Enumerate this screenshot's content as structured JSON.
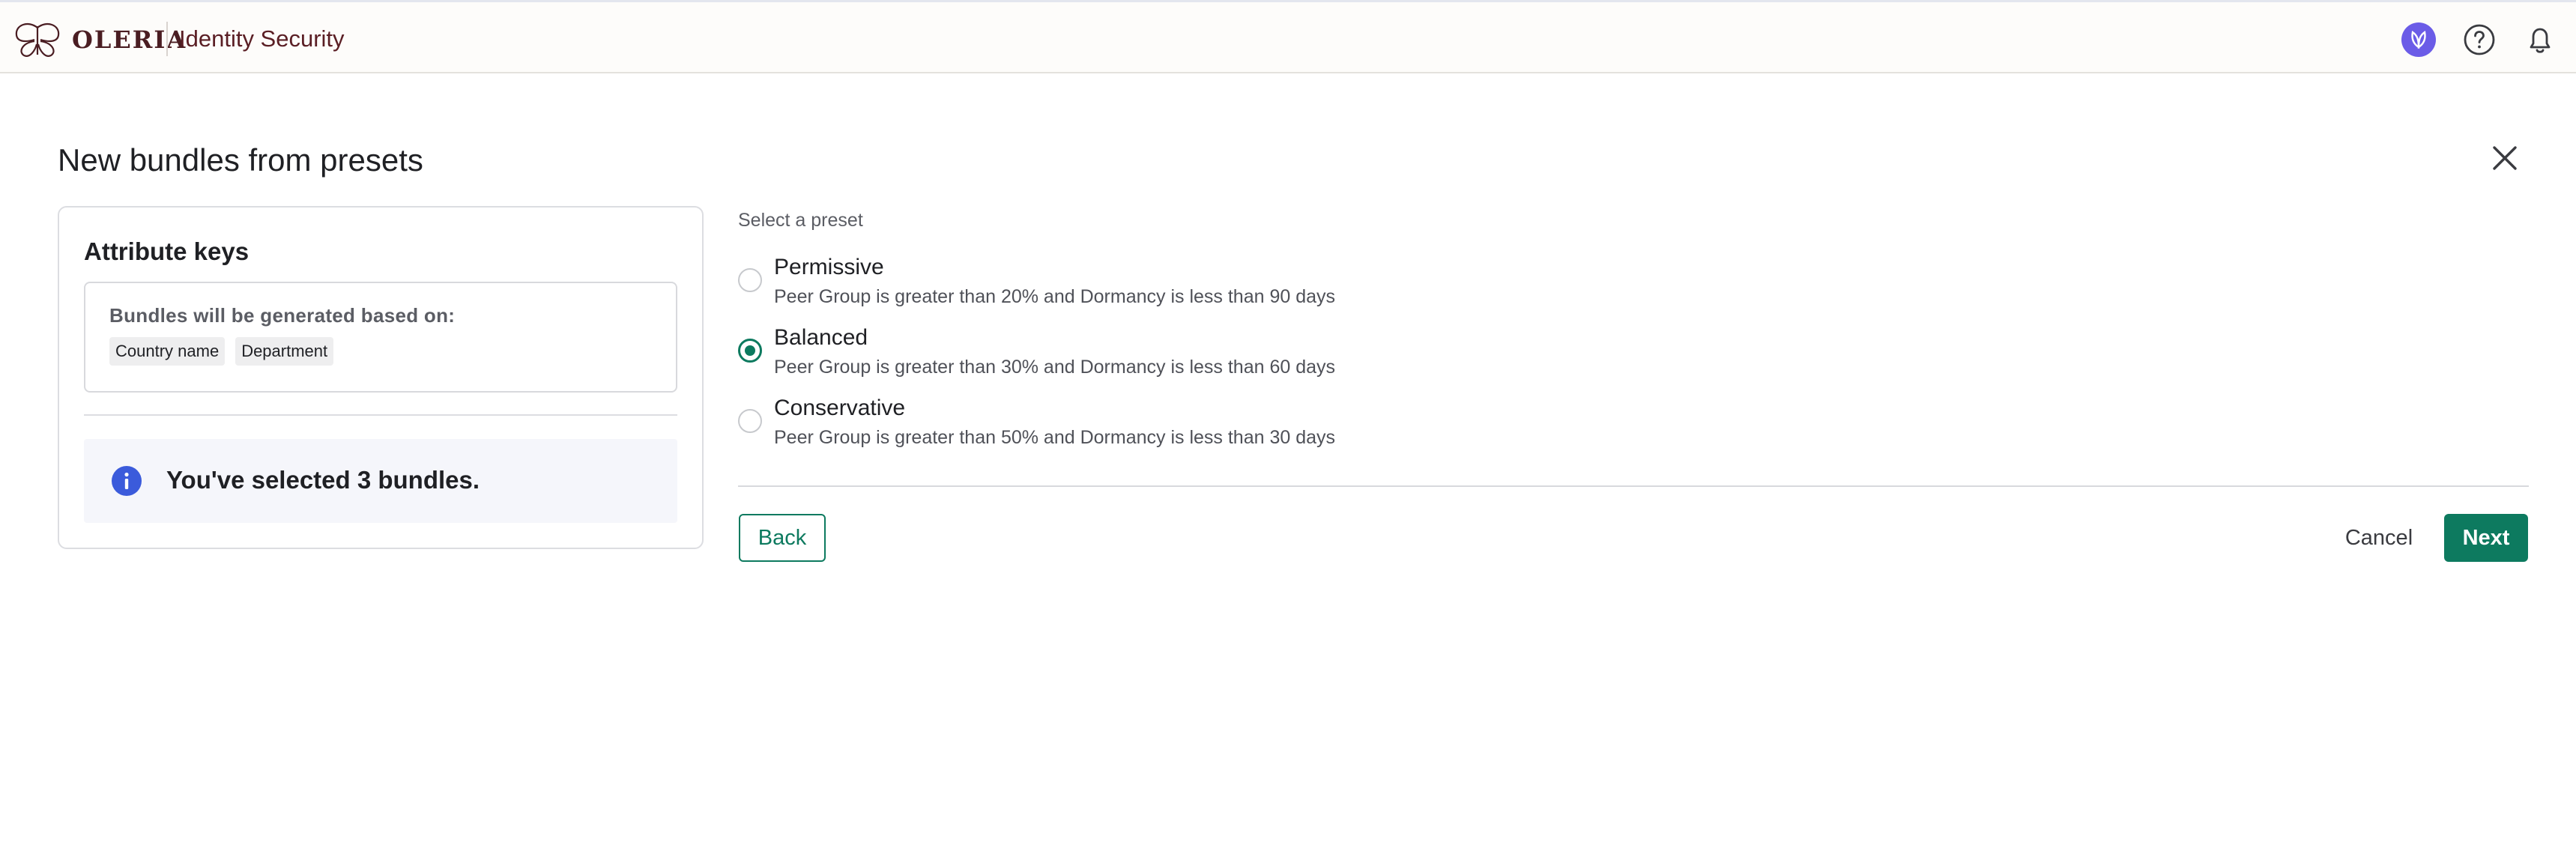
{
  "header": {
    "brand": "OLERIA",
    "product": "Identity Security",
    "icons": [
      "butterfly-logo-icon",
      "ai-assistant-icon",
      "help-icon",
      "bell-icon"
    ]
  },
  "page": {
    "title": "New bundles from presets"
  },
  "attribute_card": {
    "title": "Attribute keys",
    "basis_label": "Bundles will be generated based on:",
    "chips": [
      "Country name",
      "Department"
    ],
    "info_text": "You've selected 3 bundles."
  },
  "presets": {
    "heading": "Select a preset",
    "selected": "Balanced",
    "options": [
      {
        "label": "Permissive",
        "description": "Peer Group is greater than 20% and Dormancy is less than 90 days"
      },
      {
        "label": "Balanced",
        "description": "Peer Group is greater than 30% and Dormancy is less than 60 days"
      },
      {
        "label": "Conservative",
        "description": "Peer Group is greater than 50% and Dormancy is less than 30 days"
      }
    ]
  },
  "footer": {
    "back_label": "Back",
    "cancel_label": "Cancel",
    "next_label": "Next"
  },
  "colors": {
    "accent": "#0d7a5f",
    "brand": "#4a1d22",
    "info": "#3b5bdb",
    "ai_badge": "#6b5ce7"
  }
}
